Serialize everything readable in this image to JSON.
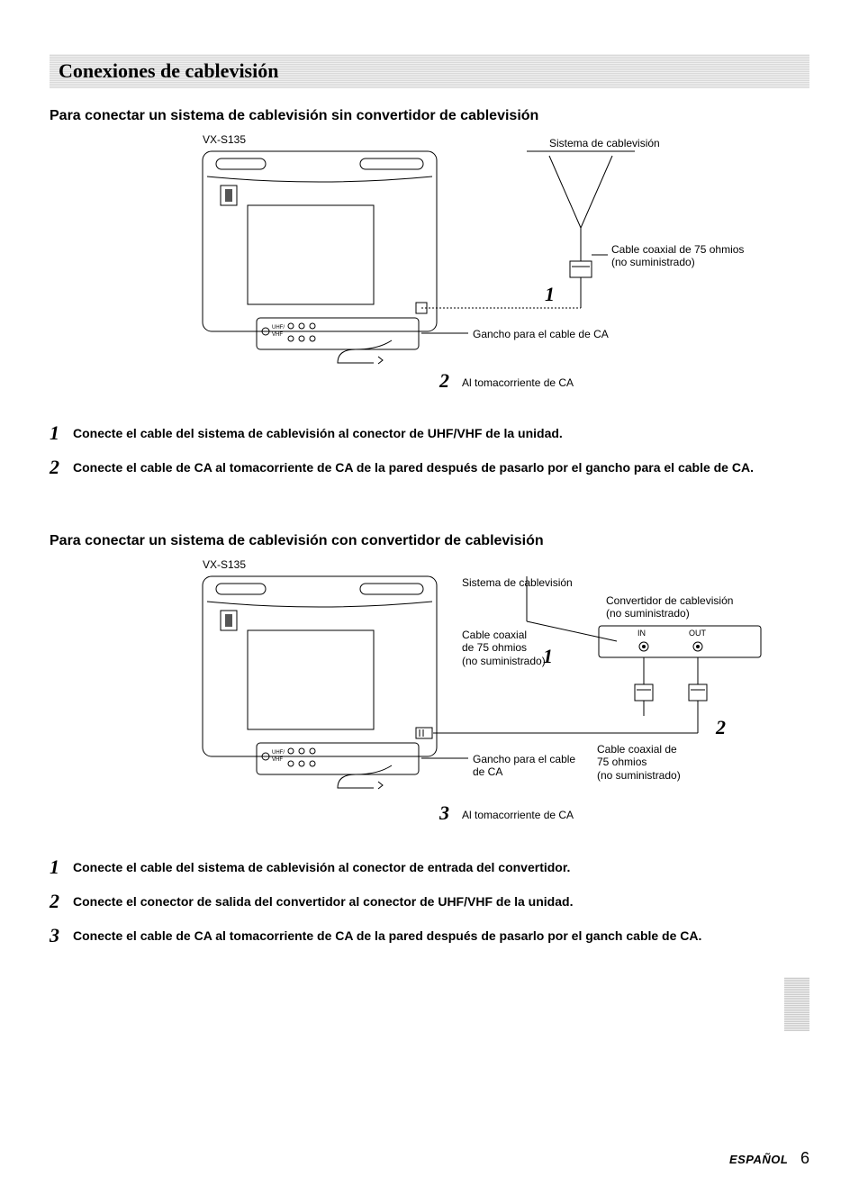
{
  "banner": {
    "title": "Conexiones de cablevisión"
  },
  "section1": {
    "heading": "Para conectar un sistema de cablevisión sin convertidor de cablevisión",
    "diagram": {
      "model": "VX-S135",
      "sys": "Sistema de cablevisión",
      "coax": "Cable coaxial de 75 ohmios\n(no suministrado)",
      "hook": "Gancho para el cable de CA",
      "ac": "Al tomacorriente de CA",
      "n1": "1",
      "n2": "2"
    },
    "steps": [
      {
        "n": "1",
        "t": "Conecte el cable del sistema de cablevisión al conector de UHF/VHF de la unidad."
      },
      {
        "n": "2",
        "t": "Conecte el cable de CA al tomacorriente de CA de la pared después de pasarlo por el gancho para el cable de CA."
      }
    ]
  },
  "section2": {
    "heading": "Para conectar un sistema de cablevisión con convertidor de cablevisión",
    "diagram": {
      "model": "VX-S135",
      "sys": "Sistema de cablevisión",
      "conv": "Convertidor de cablevisión\n(no suministrado)",
      "in": "IN",
      "out": "OUT",
      "coax1": "Cable coaxial\nde 75 ohmios\n(no suministrado)",
      "coax2": "Cable coaxial de\n75 ohmios\n(no suministrado)",
      "hook": "Gancho para el cable\nde CA",
      "ac": "Al tomacorriente de CA",
      "n1": "1",
      "n2": "2",
      "n3": "3"
    },
    "steps": [
      {
        "n": "1",
        "t": "Conecte el cable del sistema de cablevisión al conector de entrada del convertidor."
      },
      {
        "n": "2",
        "t": "Conecte el conector de salida del convertidor al conector de UHF/VHF de la unidad."
      },
      {
        "n": "3",
        "t": "Conecte el cable de CA al tomacorriente de CA de la pared después de pasarlo por el ganch cable de CA."
      }
    ]
  },
  "footer": {
    "lang": "ESPAÑOL",
    "page": "6"
  }
}
